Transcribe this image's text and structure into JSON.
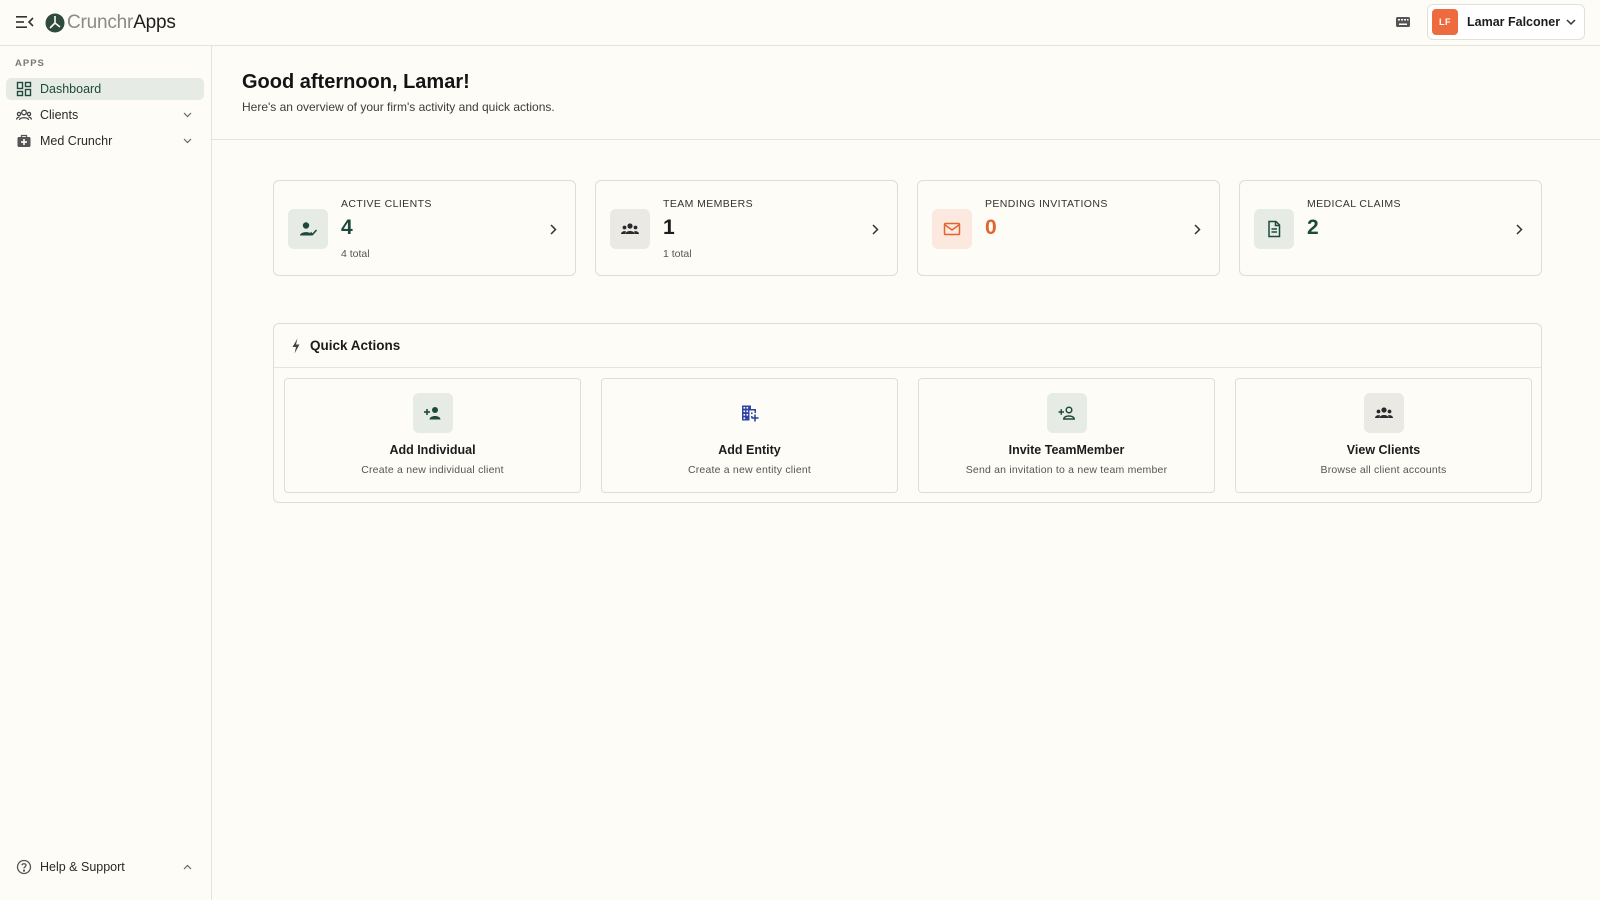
{
  "brand": {
    "name_part1": "Crunchr",
    "name_part2": "Apps"
  },
  "header": {
    "user": {
      "initials": "LF",
      "name": "Lamar Falconer"
    }
  },
  "sidebar": {
    "section_label": "APPS",
    "items": [
      {
        "label": "Dashboard",
        "icon": "dashboard-icon",
        "active": true
      },
      {
        "label": "Clients",
        "icon": "users-icon",
        "expandable": true
      },
      {
        "label": "Med Crunchr",
        "icon": "medical-bag-icon",
        "expandable": true
      }
    ],
    "footer": {
      "label": "Help & Support",
      "icon": "help-icon"
    }
  },
  "main": {
    "greeting": "Good afternoon, Lamar!",
    "subtitle": "Here's an overview of your firm's activity and quick actions.",
    "stats": [
      {
        "label": "ACTIVE CLIENTS",
        "value": "4",
        "sub": "4 total",
        "icon": "person-check-icon",
        "value_color": "#1d4a3c"
      },
      {
        "label": "TEAM MEMBERS",
        "value": "1",
        "sub": "1 total",
        "icon": "group-icon",
        "value_color": "#1c1c1c"
      },
      {
        "label": "PENDING INVITATIONS",
        "value": "0",
        "sub": "",
        "icon": "mail-icon",
        "value_color": "#e0652f"
      },
      {
        "label": "MEDICAL CLAIMS",
        "value": "2",
        "sub": "",
        "icon": "document-icon",
        "value_color": "#1d4a3c"
      }
    ],
    "quick_actions": {
      "title": "Quick Actions",
      "items": [
        {
          "name": "Add Individual",
          "desc": "Create a new individual client",
          "icon": "person-add-icon"
        },
        {
          "name": "Add Entity",
          "desc": "Create a new entity client",
          "icon": "building-add-icon"
        },
        {
          "name": "Invite TeamMember",
          "desc": "Send an invitation to a new team member",
          "icon": "person-invite-icon"
        },
        {
          "name": "View Clients",
          "desc": "Browse all client accounts",
          "icon": "group-icon"
        }
      ]
    }
  },
  "colors": {
    "background": "#fefcf6",
    "accent": "#1d4a3c",
    "orange": "#ee6b3f",
    "active_nav_bg": "#e7ebe5"
  }
}
